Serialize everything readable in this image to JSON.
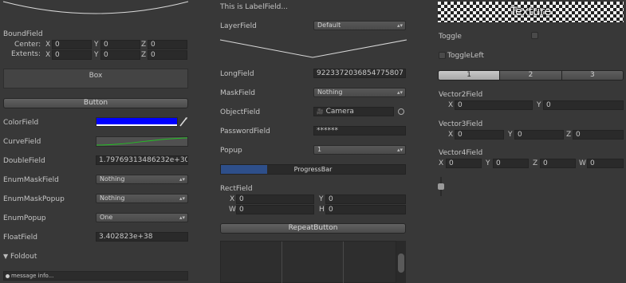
{
  "left": {
    "bound_field": {
      "title": "BoundField",
      "center_label": "Center:",
      "extents_label": "Extents:",
      "center": {
        "x": "0",
        "y": "0",
        "z": "0"
      },
      "extents": {
        "x": "0",
        "y": "0",
        "z": "0"
      }
    },
    "box_label": "Box",
    "button_label": "Button",
    "color_field_label": "ColorField",
    "color_value": "#0000ff",
    "curve_field_label": "CurveField",
    "double_field_label": "DoubleField",
    "double_value": "1.79769313486232e+308",
    "enum_mask_field_label": "EnumMaskField",
    "enum_mask_field_value": "Nothing",
    "enum_mask_popup_label": "EnumMaskPopup",
    "enum_mask_popup_value": "Nothing",
    "enum_popup_label": "EnumPopup",
    "enum_popup_value": "One",
    "float_field_label": "FloatField",
    "float_value": "3.402823e+38",
    "foldout_label": "Foldout",
    "message_text": "message info..."
  },
  "middle": {
    "label_field": "This is LabelField...",
    "layer_field_label": "LayerField",
    "layer_value": "Default",
    "long_field_label": "LongField",
    "long_value": "9223372036854775807",
    "mask_field_label": "MaskField",
    "mask_value": "Nothing",
    "object_field_label": "ObjectField",
    "object_value": "Camera",
    "password_field_label": "PasswordField",
    "password_value": "******",
    "popup_label": "Popup",
    "popup_value": "1",
    "progress_label": "ProgressBar",
    "progress_fraction": 0.25,
    "rect_field": {
      "title": "RectField",
      "x": "0",
      "y": "0",
      "w": "0",
      "h": "0"
    },
    "repeat_button_label": "RepeatButton"
  },
  "right": {
    "texture_label": "Texture",
    "toggle_label": "Toggle",
    "toggle_left_label": "ToggleLeft",
    "toolbar": [
      "1",
      "2",
      "3"
    ],
    "toolbar_selected": 0,
    "vector2": {
      "title": "Vector2Field",
      "x": "0",
      "y": "0"
    },
    "vector3": {
      "title": "Vector3Field",
      "x": "0",
      "y": "0",
      "z": "0"
    },
    "vector4": {
      "title": "Vector4Field",
      "x": "0",
      "y": "0",
      "z": "0",
      "w": "0"
    }
  },
  "axis_labels": {
    "x": "X",
    "y": "Y",
    "z": "Z",
    "w": "W",
    "h": "H"
  }
}
